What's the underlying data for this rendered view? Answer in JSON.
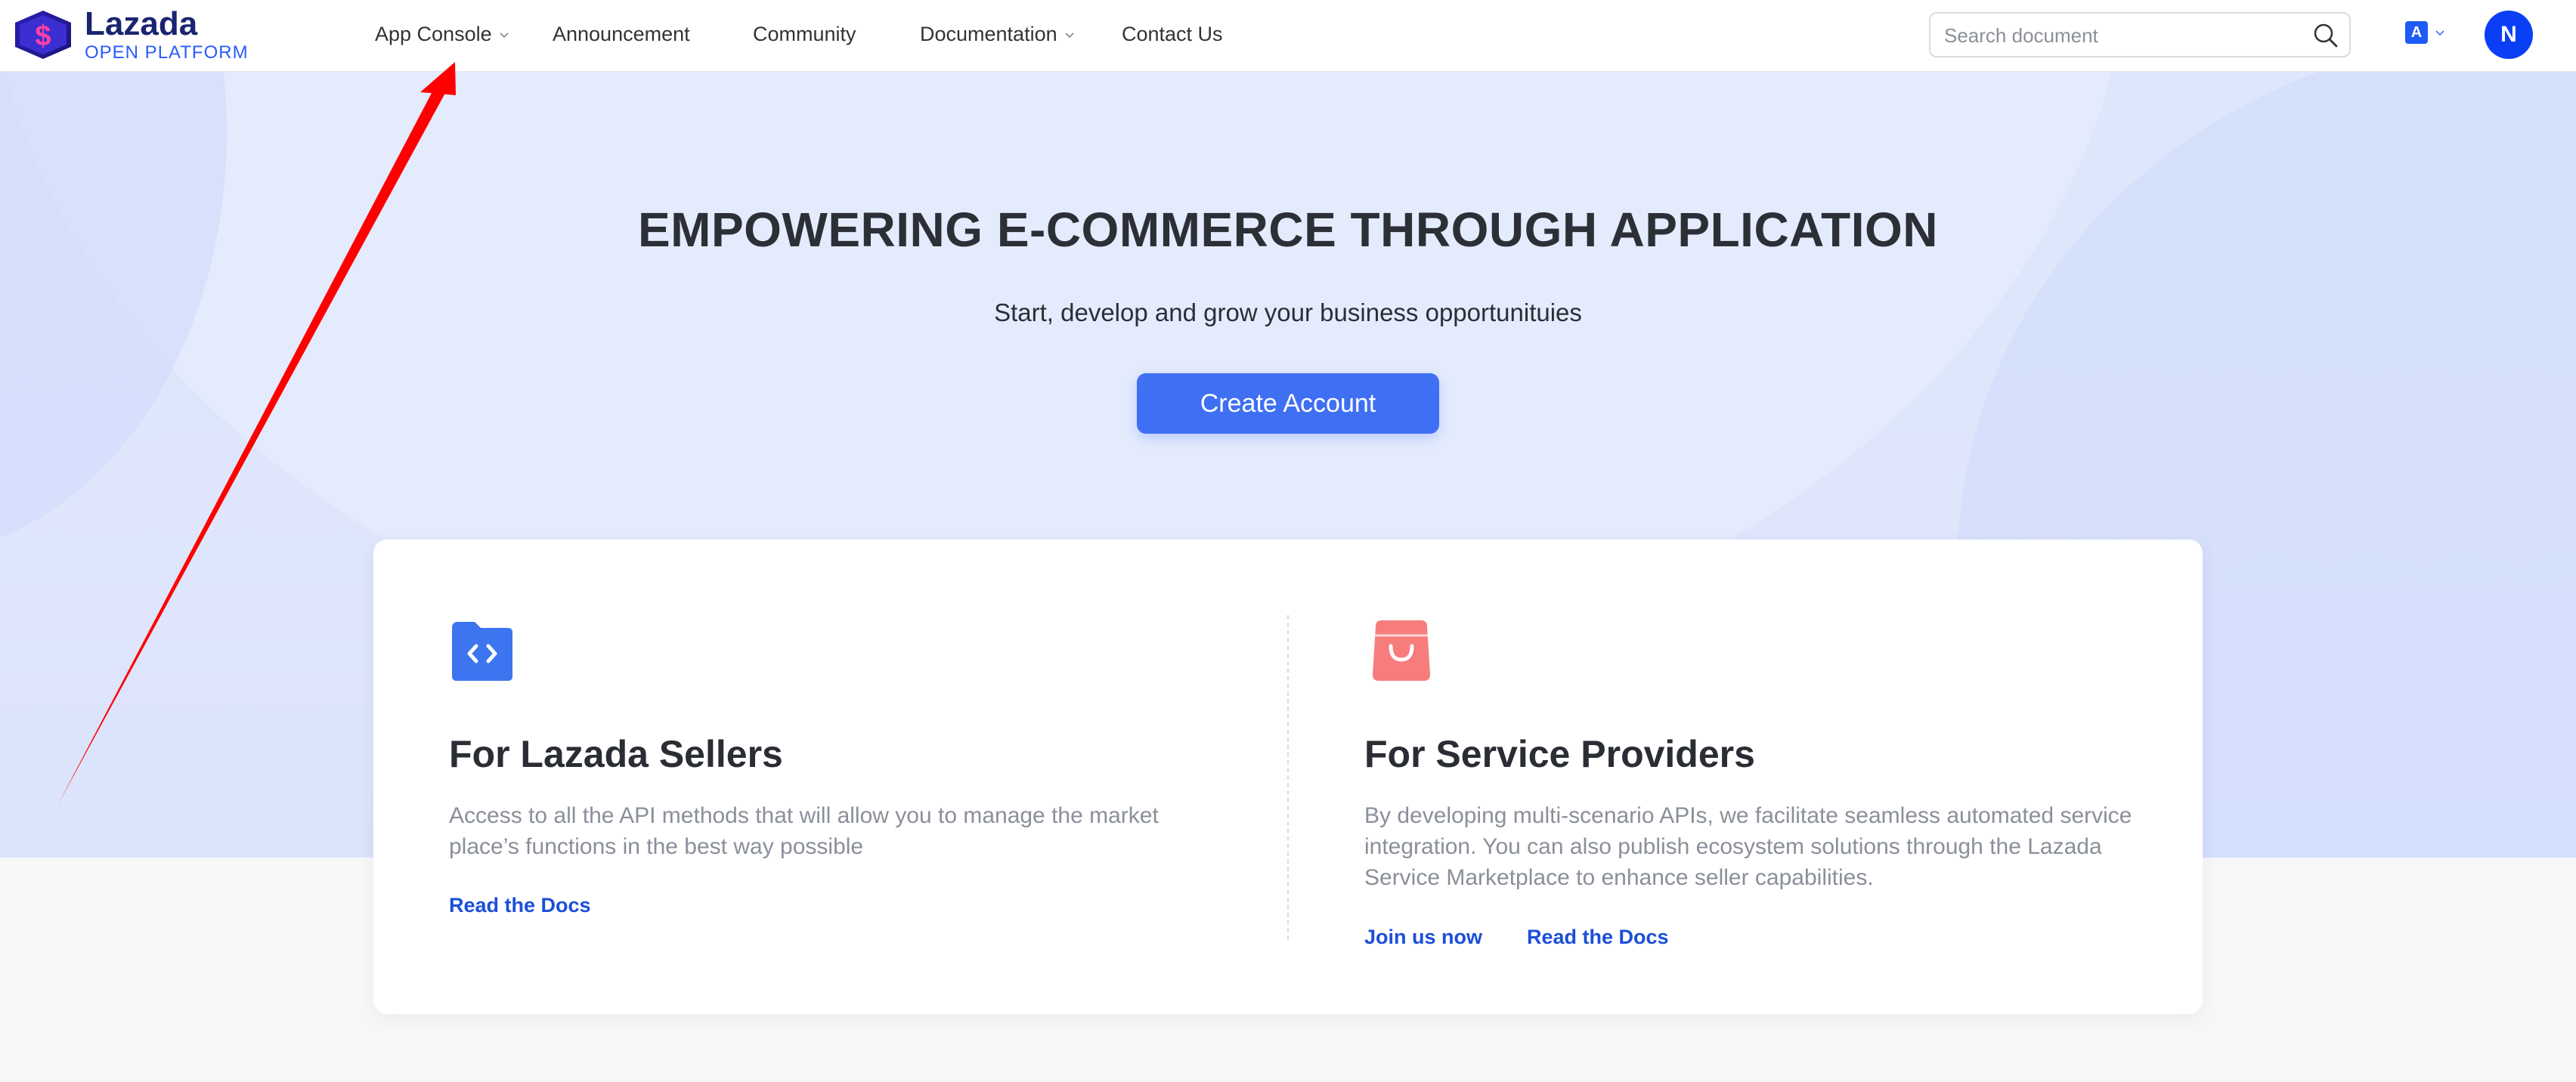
{
  "brand": {
    "name": "Lazada",
    "subtitle": "OPEN PLATFORM",
    "logo_icon": "lazada-heart-logo"
  },
  "nav": {
    "items": [
      {
        "label": "App Console",
        "has_dropdown": true
      },
      {
        "label": "Announcement",
        "has_dropdown": false
      },
      {
        "label": "Community",
        "has_dropdown": false
      },
      {
        "label": "Documentation",
        "has_dropdown": true
      },
      {
        "label": "Contact Us",
        "has_dropdown": false
      }
    ]
  },
  "search": {
    "placeholder": "Search document",
    "value": "",
    "icon": "search-icon"
  },
  "language": {
    "glyph": "A",
    "icon": "translate-icon"
  },
  "user": {
    "initial": "N"
  },
  "hero": {
    "title": "EMPOWERING E-COMMERCE THROUGH APPLICATION",
    "subtitle": "Start, develop and grow your business opportunituies",
    "cta_label": "Create Account"
  },
  "cards": [
    {
      "icon": "folder-code-icon",
      "title": "For Lazada Sellers",
      "description": "Access to all the API methods that will allow you to manage the market place’s functions in the best way possible",
      "links": [
        "Read the Docs"
      ]
    },
    {
      "icon": "shopping-bag-icon",
      "title": "For Service Providers",
      "description": "By developing multi-scenario APIs, we facilitate seamless automated service integration. You can also publish ecosystem solutions through the Lazada Service Marketplace to enhance seller capabilities.",
      "links": [
        "Join us now",
        "Read the Docs"
      ]
    }
  ],
  "colors": {
    "primary": "#3f6ff3",
    "link": "#1b4fd9",
    "hero_bg": "#dde6fb",
    "avatar": "#0b3ff5",
    "annotation_arrow": "#ff0000",
    "seller_icon": "#3d74f0",
    "provider_icon": "#f77c7c"
  }
}
